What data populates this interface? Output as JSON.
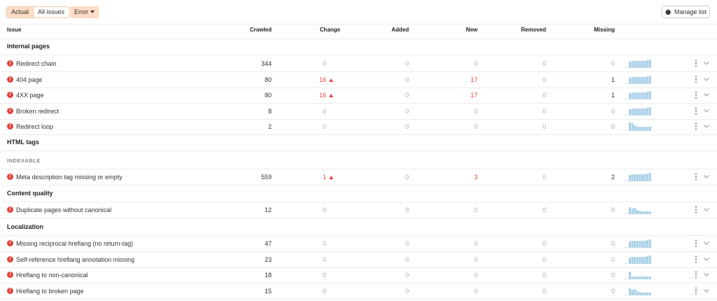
{
  "toolbar": {
    "actual_label": "Actual",
    "all_issues_label": "All issues",
    "error_filter_label": "Error",
    "manage_list_label": "Manage list"
  },
  "columns": {
    "issue": "Issue",
    "crawled": "Crawled",
    "change": "Change",
    "added": "Added",
    "new": "New",
    "removed": "Removed",
    "missing": "Missing"
  },
  "colors": {
    "accent_bg": "#fcdcc4",
    "error": "#e3413b",
    "spark_bar": "#a9d0e6",
    "muted": "#aaaaaa"
  },
  "groups": [
    {
      "title": "Internal pages",
      "rows": [
        {
          "issue": "Redirect chain",
          "crawled": "344",
          "change": "0",
          "change_up": false,
          "added": "0",
          "new": "0",
          "removed": "0",
          "missing": "0",
          "spark": "flat"
        },
        {
          "issue": "404 page",
          "crawled": "80",
          "change": "16",
          "change_up": true,
          "added": "0",
          "new": "17",
          "removed": "0",
          "missing": "1",
          "spark": "flat"
        },
        {
          "issue": "4XX page",
          "crawled": "80",
          "change": "16",
          "change_up": true,
          "added": "0",
          "new": "17",
          "removed": "0",
          "missing": "1",
          "spark": "flat"
        },
        {
          "issue": "Broken redirect",
          "crawled": "8",
          "change": "0",
          "change_up": false,
          "added": "0",
          "new": "0",
          "removed": "0",
          "missing": "0",
          "spark": "flat"
        },
        {
          "issue": "Redirect loop",
          "crawled": "2",
          "change": "0",
          "change_up": false,
          "added": "0",
          "new": "0",
          "removed": "0",
          "missing": "0",
          "spark": "step"
        }
      ]
    },
    {
      "title": "HTML tags",
      "subsection": "INDEXABLE",
      "rows": [
        {
          "issue": "Meta description tag missing or empty",
          "crawled": "559",
          "change": "1",
          "change_up": true,
          "added": "0",
          "new": "3",
          "removed": "0",
          "missing": "2",
          "spark": "flat"
        }
      ]
    },
    {
      "title": "Content quality",
      "rows": [
        {
          "issue": "Duplicate pages without canonical",
          "crawled": "12",
          "change": "0",
          "change_up": false,
          "added": "0",
          "new": "0",
          "removed": "0",
          "missing": "0",
          "spark": "varied"
        }
      ]
    },
    {
      "title": "Localization",
      "rows": [
        {
          "issue": "Missing reciprocal hreflang (no return-tag)",
          "crawled": "47",
          "change": "0",
          "change_up": false,
          "added": "0",
          "new": "0",
          "removed": "0",
          "missing": "0",
          "spark": "flat"
        },
        {
          "issue": "Self-reference hreflang annotation missing",
          "crawled": "23",
          "change": "0",
          "change_up": false,
          "added": "0",
          "new": "0",
          "removed": "0",
          "missing": "0",
          "spark": "flat"
        },
        {
          "issue": "Hreflang to non-canonical",
          "crawled": "18",
          "change": "0",
          "change_up": false,
          "added": "0",
          "new": "0",
          "removed": "0",
          "missing": "0",
          "spark": "low"
        },
        {
          "issue": "Hreflang to broken page",
          "crawled": "15",
          "change": "0",
          "change_up": false,
          "added": "0",
          "new": "0",
          "removed": "0",
          "missing": "0",
          "spark": "varied"
        }
      ]
    }
  ]
}
